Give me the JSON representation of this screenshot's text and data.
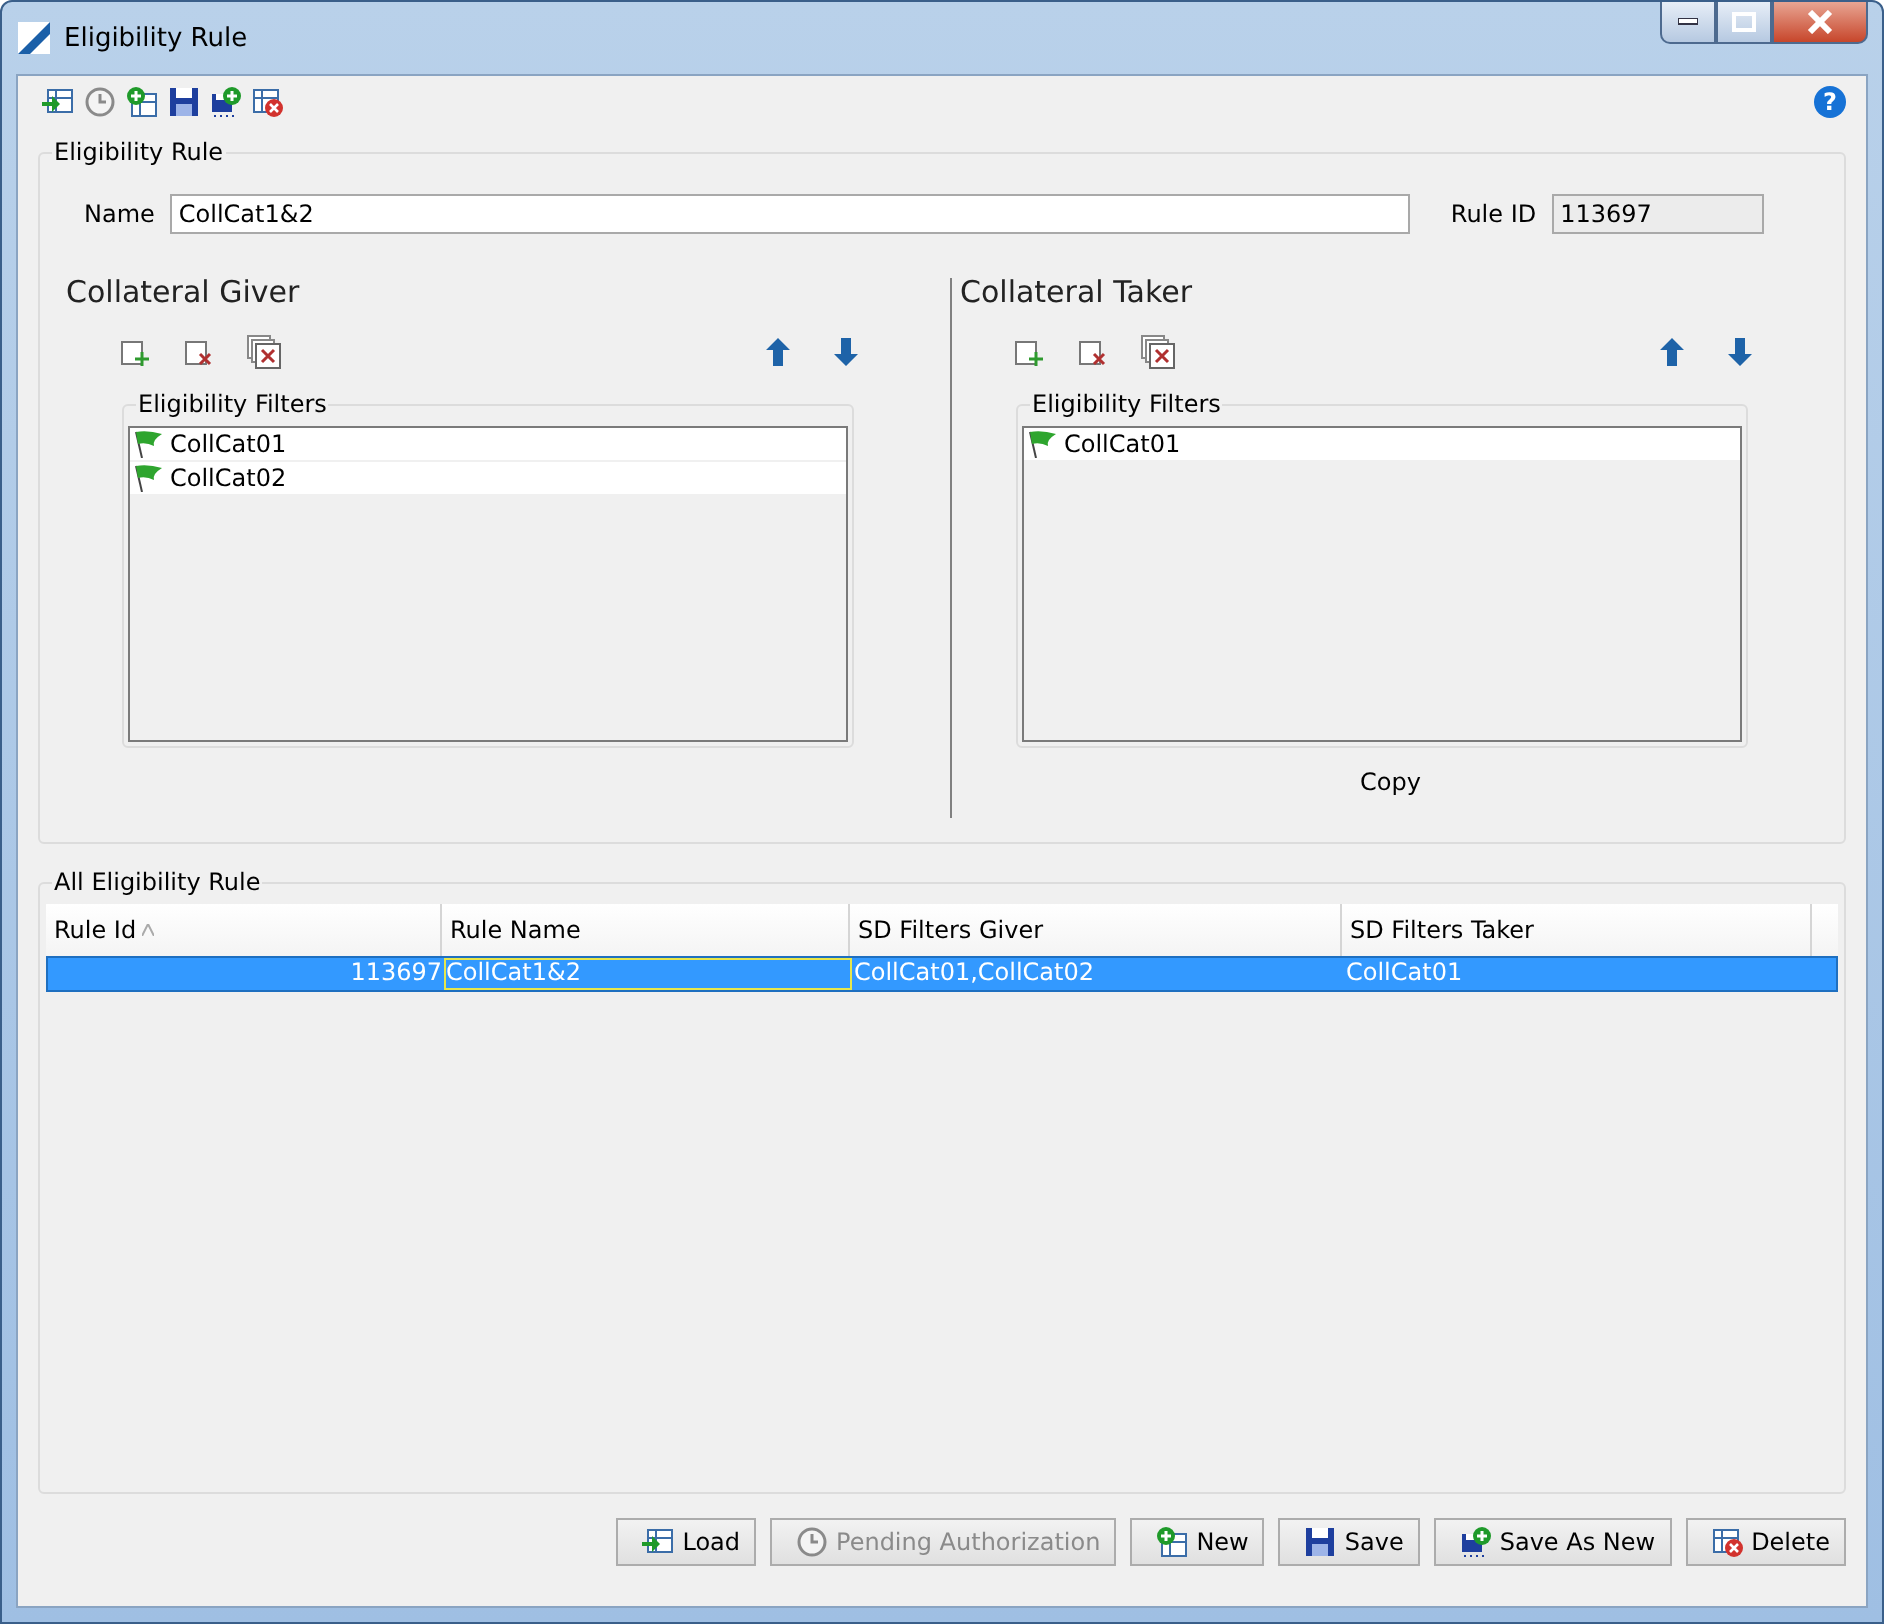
{
  "window": {
    "title": "Eligibility Rule"
  },
  "help": "?",
  "rule": {
    "title": "Eligibility Rule",
    "name_label": "Name",
    "name_value": "CollCat1&2",
    "rule_id_label": "Rule ID",
    "rule_id_value": "113697"
  },
  "giver": {
    "title": "Collateral Giver",
    "filters_title": "Eligibility Filters",
    "filters": [
      {
        "label": "CollCat01"
      },
      {
        "label": "CollCat02"
      }
    ]
  },
  "taker": {
    "title": "Collateral Taker",
    "filters_title": "Eligibility Filters",
    "filters": [
      {
        "label": "CollCat01"
      }
    ],
    "footer": "Copy"
  },
  "table": {
    "title": "All Eligibility Rule",
    "columns": [
      {
        "label": "Rule Id",
        "sorted": true
      },
      {
        "label": "Rule Name",
        "sorted": false
      },
      {
        "label": "SD Filters Giver",
        "sorted": false
      },
      {
        "label": "SD Filters Taker",
        "sorted": false
      }
    ],
    "rows": [
      {
        "selected": true,
        "cells": [
          {
            "text": "113697",
            "focused": false
          },
          {
            "text": "CollCat1&2",
            "focused": true
          },
          {
            "text": "CollCat01,CollCat02",
            "focused": false
          },
          {
            "text": "CollCat01",
            "focused": false
          }
        ]
      }
    ]
  },
  "buttons": [
    {
      "kind": "load",
      "label": "Load",
      "disabled": false
    },
    {
      "kind": "pending",
      "label": "Pending Authorization",
      "disabled": true
    },
    {
      "kind": "new",
      "label": "New",
      "disabled": false
    },
    {
      "kind": "save",
      "label": "Save",
      "disabled": false
    },
    {
      "kind": "saveas",
      "label": "Save As New",
      "disabled": false
    },
    {
      "kind": "delete",
      "label": "Delete",
      "disabled": false
    }
  ]
}
